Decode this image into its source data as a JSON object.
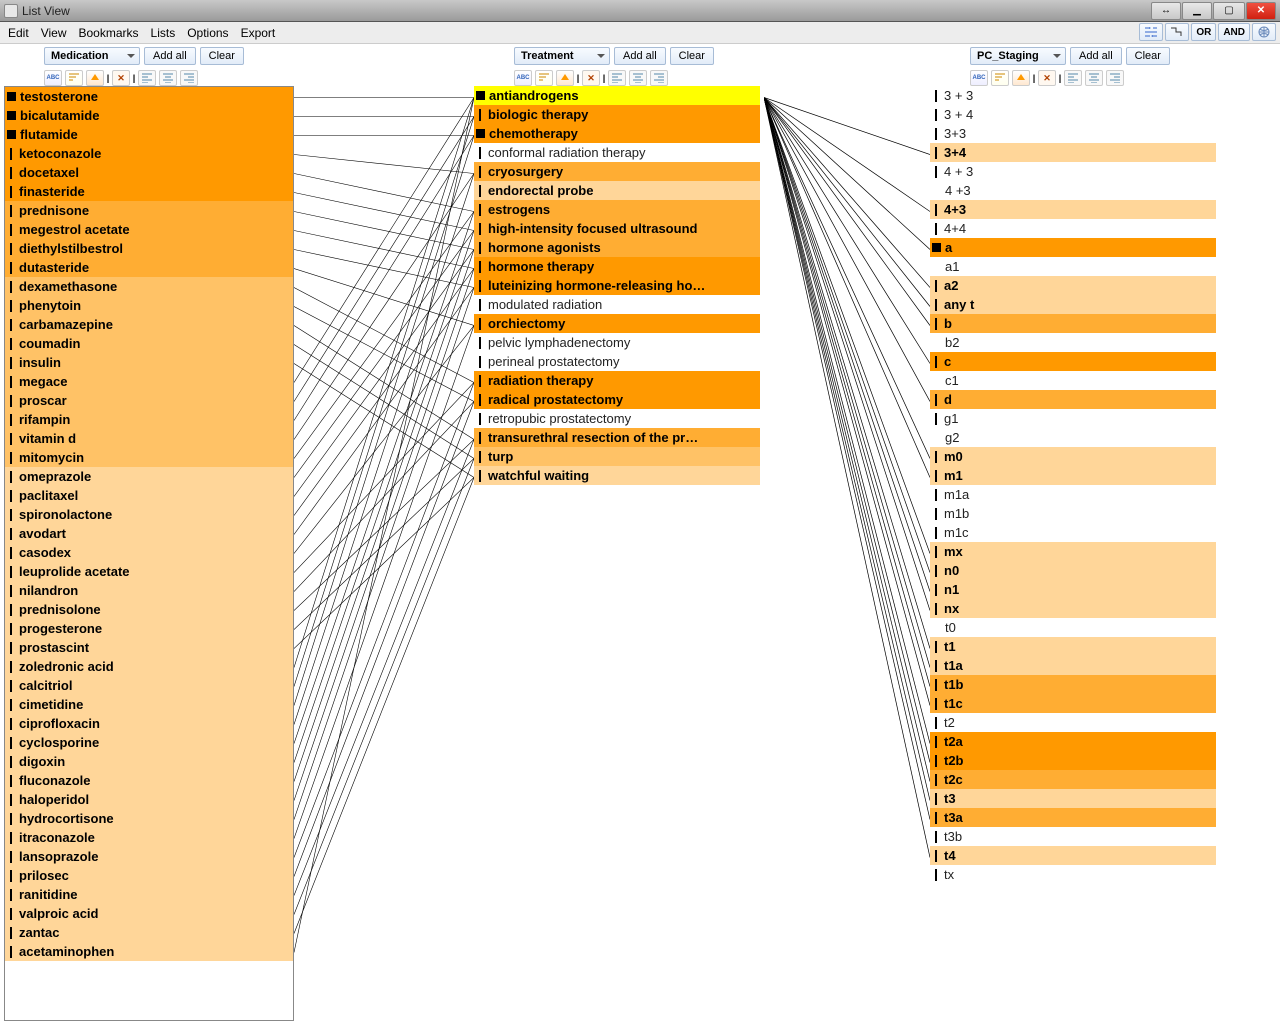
{
  "window": {
    "title": "List View",
    "menus": [
      "Edit",
      "View",
      "Bookmarks",
      "Lists",
      "Options",
      "Export"
    ],
    "logic_buttons": {
      "or": "OR",
      "and": "AND"
    }
  },
  "columns": [
    {
      "id": "medication",
      "dropdown_label": "Medication",
      "addall_label": "Add all",
      "clear_label": "Clear",
      "items": [
        {
          "label": "testosterone",
          "weight": 5,
          "mark": "sq"
        },
        {
          "label": "bicalutamide",
          "weight": 5,
          "mark": "sq"
        },
        {
          "label": "flutamide",
          "weight": 5,
          "mark": "sq"
        },
        {
          "label": "ketoconazole",
          "weight": 5,
          "mark": "bar"
        },
        {
          "label": "docetaxel",
          "weight": 5,
          "mark": "bar"
        },
        {
          "label": "finasteride",
          "weight": 5,
          "mark": "bar"
        },
        {
          "label": "prednisone",
          "weight": 4,
          "mark": "bar"
        },
        {
          "label": "megestrol acetate",
          "weight": 4,
          "mark": "bar"
        },
        {
          "label": "diethylstilbestrol",
          "weight": 4,
          "mark": "bar"
        },
        {
          "label": "dutasteride",
          "weight": 4,
          "mark": "bar"
        },
        {
          "label": "dexamethasone",
          "weight": 3,
          "mark": "bar"
        },
        {
          "label": "phenytoin",
          "weight": 3,
          "mark": "bar"
        },
        {
          "label": "carbamazepine",
          "weight": 3,
          "mark": "bar"
        },
        {
          "label": "coumadin",
          "weight": 3,
          "mark": "bar"
        },
        {
          "label": "insulin",
          "weight": 3,
          "mark": "bar"
        },
        {
          "label": "megace",
          "weight": 3,
          "mark": "bar"
        },
        {
          "label": "proscar",
          "weight": 3,
          "mark": "bar"
        },
        {
          "label": "rifampin",
          "weight": 3,
          "mark": "bar"
        },
        {
          "label": "vitamin d",
          "weight": 3,
          "mark": "bar"
        },
        {
          "label": "mitomycin",
          "weight": 3,
          "mark": "bar"
        },
        {
          "label": "omeprazole",
          "weight": 2,
          "mark": "bar"
        },
        {
          "label": "paclitaxel",
          "weight": 2,
          "mark": "bar"
        },
        {
          "label": "spironolactone",
          "weight": 2,
          "mark": "bar"
        },
        {
          "label": "avodart",
          "weight": 2,
          "mark": "bar"
        },
        {
          "label": "casodex",
          "weight": 2,
          "mark": "bar"
        },
        {
          "label": "leuprolide acetate",
          "weight": 2,
          "mark": "bar"
        },
        {
          "label": "nilandron",
          "weight": 2,
          "mark": "bar"
        },
        {
          "label": "prednisolone",
          "weight": 2,
          "mark": "bar"
        },
        {
          "label": "progesterone",
          "weight": 2,
          "mark": "bar"
        },
        {
          "label": "prostascint",
          "weight": 2,
          "mark": "bar"
        },
        {
          "label": "zoledronic acid",
          "weight": 2,
          "mark": "bar"
        },
        {
          "label": "calcitriol",
          "weight": 2,
          "mark": "bar"
        },
        {
          "label": "cimetidine",
          "weight": 2,
          "mark": "bar"
        },
        {
          "label": "ciprofloxacin",
          "weight": 2,
          "mark": "bar"
        },
        {
          "label": "cyclosporine",
          "weight": 2,
          "mark": "bar"
        },
        {
          "label": "digoxin",
          "weight": 2,
          "mark": "bar"
        },
        {
          "label": "fluconazole",
          "weight": 2,
          "mark": "bar"
        },
        {
          "label": "haloperidol",
          "weight": 2,
          "mark": "bar"
        },
        {
          "label": "hydrocortisone",
          "weight": 2,
          "mark": "bar"
        },
        {
          "label": "itraconazole",
          "weight": 2,
          "mark": "bar"
        },
        {
          "label": "lansoprazole",
          "weight": 2,
          "mark": "bar"
        },
        {
          "label": "prilosec",
          "weight": 2,
          "mark": "bar"
        },
        {
          "label": "ranitidine",
          "weight": 2,
          "mark": "bar"
        },
        {
          "label": "valproic acid",
          "weight": 2,
          "mark": "bar"
        },
        {
          "label": "zantac",
          "weight": 2,
          "mark": "bar"
        },
        {
          "label": "acetaminophen",
          "weight": 2,
          "mark": "bar"
        }
      ]
    },
    {
      "id": "treatment",
      "dropdown_label": "Treatment",
      "addall_label": "Add all",
      "clear_label": "Clear",
      "items": [
        {
          "label": "antiandrogens",
          "weight": "5y",
          "mark": "sq"
        },
        {
          "label": "biologic therapy",
          "weight": 5,
          "mark": "bar"
        },
        {
          "label": "chemotherapy",
          "weight": 5,
          "mark": "sq"
        },
        {
          "label": "conformal radiation therapy",
          "weight": 0,
          "mark": "bar"
        },
        {
          "label": "cryosurgery",
          "weight": 4,
          "mark": "bar"
        },
        {
          "label": "endorectal probe",
          "weight": 2,
          "mark": "bar"
        },
        {
          "label": "estrogens",
          "weight": 4,
          "mark": "bar"
        },
        {
          "label": "high-intensity focused ultrasound",
          "weight": 4,
          "mark": "bar"
        },
        {
          "label": "hormone agonists",
          "weight": 4,
          "mark": "bar"
        },
        {
          "label": "hormone therapy",
          "weight": 5,
          "mark": "bar"
        },
        {
          "label": "luteinizing hormone-releasing ho…",
          "weight": 5,
          "mark": "bar"
        },
        {
          "label": "modulated radiation",
          "weight": 0,
          "mark": "bar"
        },
        {
          "label": "orchiectomy",
          "weight": 5,
          "mark": "bar"
        },
        {
          "label": "pelvic lymphadenectomy",
          "weight": 0,
          "mark": "bar"
        },
        {
          "label": "perineal prostatectomy",
          "weight": 0,
          "mark": "bar"
        },
        {
          "label": "radiation therapy",
          "weight": 5,
          "mark": "bar"
        },
        {
          "label": "radical prostatectomy",
          "weight": 5,
          "mark": "bar"
        },
        {
          "label": "retropubic prostatectomy",
          "weight": 0,
          "mark": "bar"
        },
        {
          "label": "transurethral resection of the pr…",
          "weight": 4,
          "mark": "bar"
        },
        {
          "label": "turp",
          "weight": 3,
          "mark": "bar"
        },
        {
          "label": "watchful waiting",
          "weight": 2,
          "mark": "bar"
        }
      ]
    },
    {
      "id": "pc_staging",
      "dropdown_label": "PC_Staging",
      "addall_label": "Add all",
      "clear_label": "Clear",
      "items": [
        {
          "label": "3 + 3",
          "weight": 0,
          "mark": "bar"
        },
        {
          "label": "3 + 4",
          "weight": 0,
          "mark": "bar"
        },
        {
          "label": "3+3",
          "weight": 0,
          "mark": "bar"
        },
        {
          "label": "3+4",
          "weight": 2,
          "mark": "bar"
        },
        {
          "label": "4 + 3",
          "weight": 0,
          "mark": "bar"
        },
        {
          "label": " 4 +3",
          "weight": 0,
          "mark": "none"
        },
        {
          "label": "4+3",
          "weight": 2,
          "mark": "bar"
        },
        {
          "label": "4+4",
          "weight": 0,
          "mark": "bar"
        },
        {
          "label": "a",
          "weight": 5,
          "mark": "sq"
        },
        {
          "label": " a1",
          "weight": 0,
          "mark": "none"
        },
        {
          "label": "a2",
          "weight": 2,
          "mark": "bar"
        },
        {
          "label": "any t",
          "weight": 2,
          "mark": "bar"
        },
        {
          "label": "b",
          "weight": 4,
          "mark": "bar"
        },
        {
          "label": " b2",
          "weight": 0,
          "mark": "none"
        },
        {
          "label": "c",
          "weight": 5,
          "mark": "bar"
        },
        {
          "label": " c1",
          "weight": 0,
          "mark": "none"
        },
        {
          "label": "d",
          "weight": 4,
          "mark": "bar"
        },
        {
          "label": "g1",
          "weight": 0,
          "mark": "bar"
        },
        {
          "label": " g2",
          "weight": 0,
          "mark": "none"
        },
        {
          "label": "m0",
          "weight": 2,
          "mark": "bar"
        },
        {
          "label": "m1",
          "weight": 2,
          "mark": "bar"
        },
        {
          "label": "m1a",
          "weight": 0,
          "mark": "bar"
        },
        {
          "label": "m1b",
          "weight": 0,
          "mark": "bar"
        },
        {
          "label": "m1c",
          "weight": 0,
          "mark": "bar"
        },
        {
          "label": "mx",
          "weight": 2,
          "mark": "bar"
        },
        {
          "label": "n0",
          "weight": 2,
          "mark": "bar"
        },
        {
          "label": "n1",
          "weight": 2,
          "mark": "bar"
        },
        {
          "label": "nx",
          "weight": 2,
          "mark": "bar"
        },
        {
          "label": " t0",
          "weight": 0,
          "mark": "none"
        },
        {
          "label": "t1",
          "weight": 2,
          "mark": "bar"
        },
        {
          "label": "t1a",
          "weight": 2,
          "mark": "bar"
        },
        {
          "label": "t1b",
          "weight": 4,
          "mark": "bar"
        },
        {
          "label": "t1c",
          "weight": 4,
          "mark": "bar"
        },
        {
          "label": "t2",
          "weight": 0,
          "mark": "bar"
        },
        {
          "label": "t2a",
          "weight": 5,
          "mark": "bar"
        },
        {
          "label": "t2b",
          "weight": 5,
          "mark": "bar"
        },
        {
          "label": "t2c",
          "weight": 4,
          "mark": "bar"
        },
        {
          "label": "t3",
          "weight": 2,
          "mark": "bar"
        },
        {
          "label": "t3a",
          "weight": 4,
          "mark": "bar"
        },
        {
          "label": "t3b",
          "weight": 0,
          "mark": "bar"
        },
        {
          "label": "t4",
          "weight": 2,
          "mark": "bar"
        },
        {
          "label": "tx",
          "weight": 0,
          "mark": "bar"
        }
      ]
    }
  ],
  "connectors": {
    "ab": {
      "left_count": 46,
      "left_row_h": 19,
      "right_targets_rows": [
        0,
        1,
        2,
        4,
        6,
        7,
        8,
        9,
        10,
        12,
        15,
        16,
        18,
        19,
        20
      ]
    },
    "bc": {
      "source_row": 0,
      "right_targets_rows": [
        3,
        6,
        8,
        10,
        11,
        12,
        14,
        16,
        19,
        20,
        24,
        25,
        26,
        27,
        29,
        30,
        31,
        32,
        34,
        35,
        36,
        37,
        38,
        40
      ]
    }
  }
}
